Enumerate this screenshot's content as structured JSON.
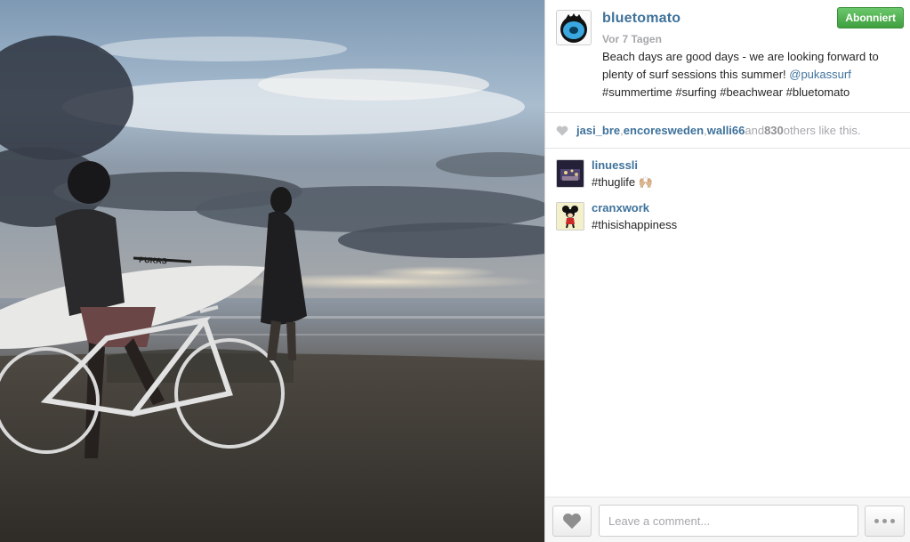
{
  "post": {
    "owner": "bluetomato",
    "follow_label": "Abonniert",
    "age": "Vor 7 Tagen",
    "caption_text": "Beach days are good days - we are looking forward to plenty of surf sessions this summer! ",
    "caption_mention": "@pukassurf",
    "caption_tags": "#summertime #surfing #beachwear #bluetomato",
    "photo_icon": "beach-surfers-photo",
    "surfboard_brand": "PUKAS"
  },
  "likes": {
    "user1": "jasi_bre",
    "sep1": ", ",
    "user2": "encoresweden",
    "sep2": ", ",
    "user3": "walli66",
    "and": " and ",
    "count": "830",
    "suffix": " others like this."
  },
  "comments": [
    {
      "user": "linuessli",
      "text": "#thuglife 🙌🏼",
      "avatar_icon": "night-photo-avatar"
    },
    {
      "user": "cranxwork",
      "text": "#thisishappiness",
      "avatar_icon": "mickey-mouse-avatar"
    }
  ],
  "footer": {
    "comment_placeholder": "Leave a comment...",
    "like_icon": "heart-icon",
    "more_icon": "more-options-icon"
  },
  "colors": {
    "link": "#3f729b",
    "follow_green": "#4cae4c",
    "muted": "#a5a7aa"
  }
}
